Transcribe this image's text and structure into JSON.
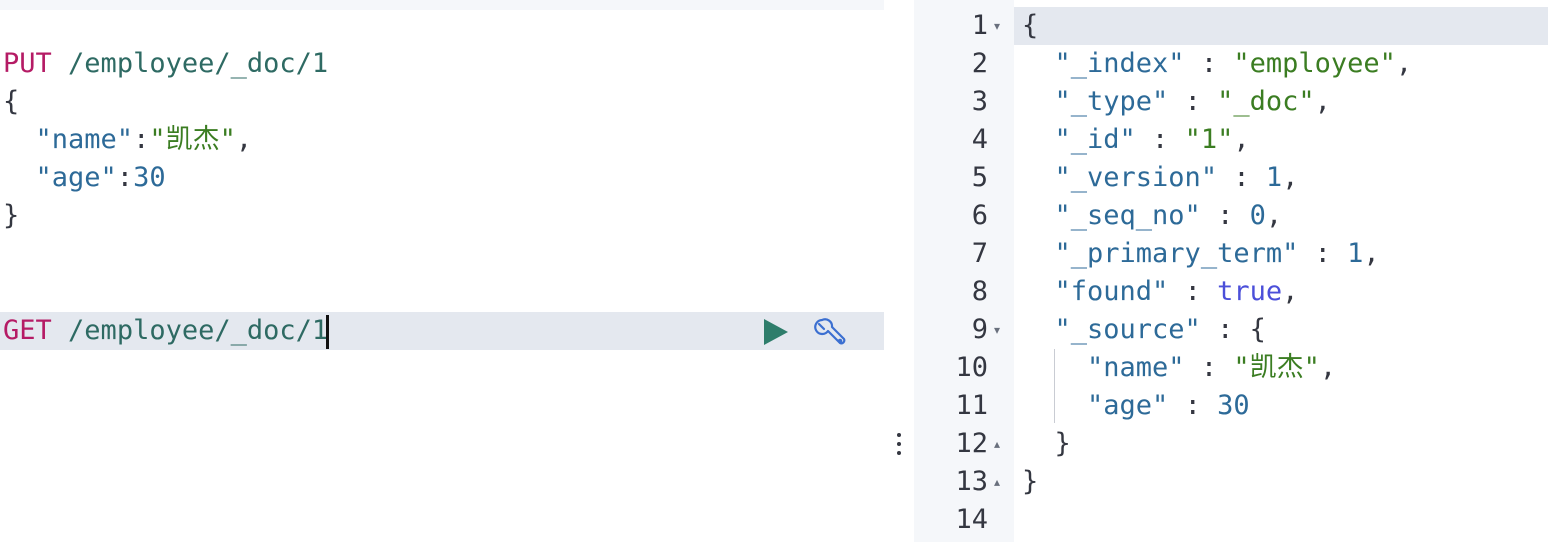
{
  "editor": {
    "put_request": {
      "method": "PUT",
      "path": "/employee/_doc/1",
      "open_brace": "{",
      "name_key": "\"name\"",
      "name_value": "\"凯杰\"",
      "age_key": "\"age\"",
      "age_value": "30",
      "close_brace": "}"
    },
    "get_request": {
      "method": "GET",
      "path": "/employee/_doc/1"
    },
    "actions": {
      "run_icon": "play-icon",
      "settings_icon": "wrench-icon"
    }
  },
  "output": {
    "line_numbers": [
      "1",
      "2",
      "3",
      "4",
      "5",
      "6",
      "7",
      "8",
      "9",
      "10",
      "11",
      "12",
      "13",
      "14"
    ],
    "fold_markers": {
      "1": "▾",
      "9": "▾",
      "12": "▴",
      "13": "▴"
    },
    "response": {
      "open": "{",
      "index_key": "\"_index\"",
      "index_value": "\"employee\"",
      "type_key": "\"_type\"",
      "type_value": "\"_doc\"",
      "id_key": "\"_id\"",
      "id_value": "\"1\"",
      "version_key": "\"_version\"",
      "version_value": "1",
      "seq_key": "\"_seq_no\"",
      "seq_value": "0",
      "term_key": "\"_primary_term\"",
      "term_value": "1",
      "found_key": "\"found\"",
      "found_value": "true",
      "source_key": "\"_source\"",
      "source_open": "{",
      "name_key": "\"name\"",
      "name_value": "\"凯杰\"",
      "age_key": "\"age\"",
      "age_value": "30",
      "source_close": "}",
      "close": "}"
    }
  },
  "colors": {
    "method": "#b51b65",
    "url": "#2e6a63",
    "key": "#2d6a98",
    "string": "#3b7d22",
    "boolean": "#4b4fd9",
    "active_line": "#e4e8ef",
    "gutter": "#f5f7fa",
    "run_button": "#2e7d6b",
    "wrench": "#3b6fd1"
  }
}
